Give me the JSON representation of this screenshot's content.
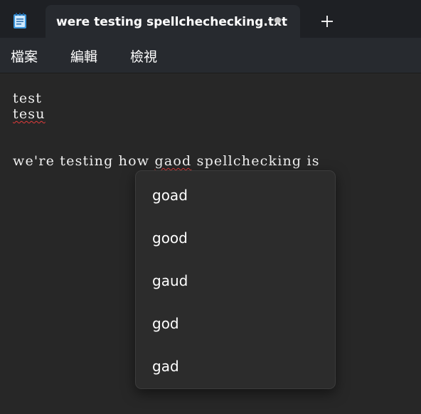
{
  "titlebar": {
    "app_icon": "notepad-icon",
    "tab": {
      "title": "were testing spellchechecking.txt",
      "unsaved_indicator": "dot-icon"
    },
    "new_tab_icon": "plus-icon"
  },
  "menu": {
    "items": [
      {
        "label": "檔案"
      },
      {
        "label": "編輯"
      },
      {
        "label": "檢視"
      }
    ]
  },
  "editor": {
    "lines": [
      {
        "text": "test"
      },
      {
        "text": "tesu",
        "misspelled": true
      },
      {
        "text": ""
      },
      {
        "before": "we're testing how ",
        "misspelled_word": "gaod",
        "after": " spellchecking is"
      }
    ],
    "spell_menu": {
      "suggestions": [
        "goad",
        "good",
        "gaud",
        "god",
        "gad"
      ]
    }
  },
  "colors": {
    "titlebar_bg": "#1e2024",
    "tab_bg": "#272a2f",
    "editor_bg": "#272727",
    "popup_bg": "#2c2c2c",
    "squiggle": "#e23b3b"
  }
}
